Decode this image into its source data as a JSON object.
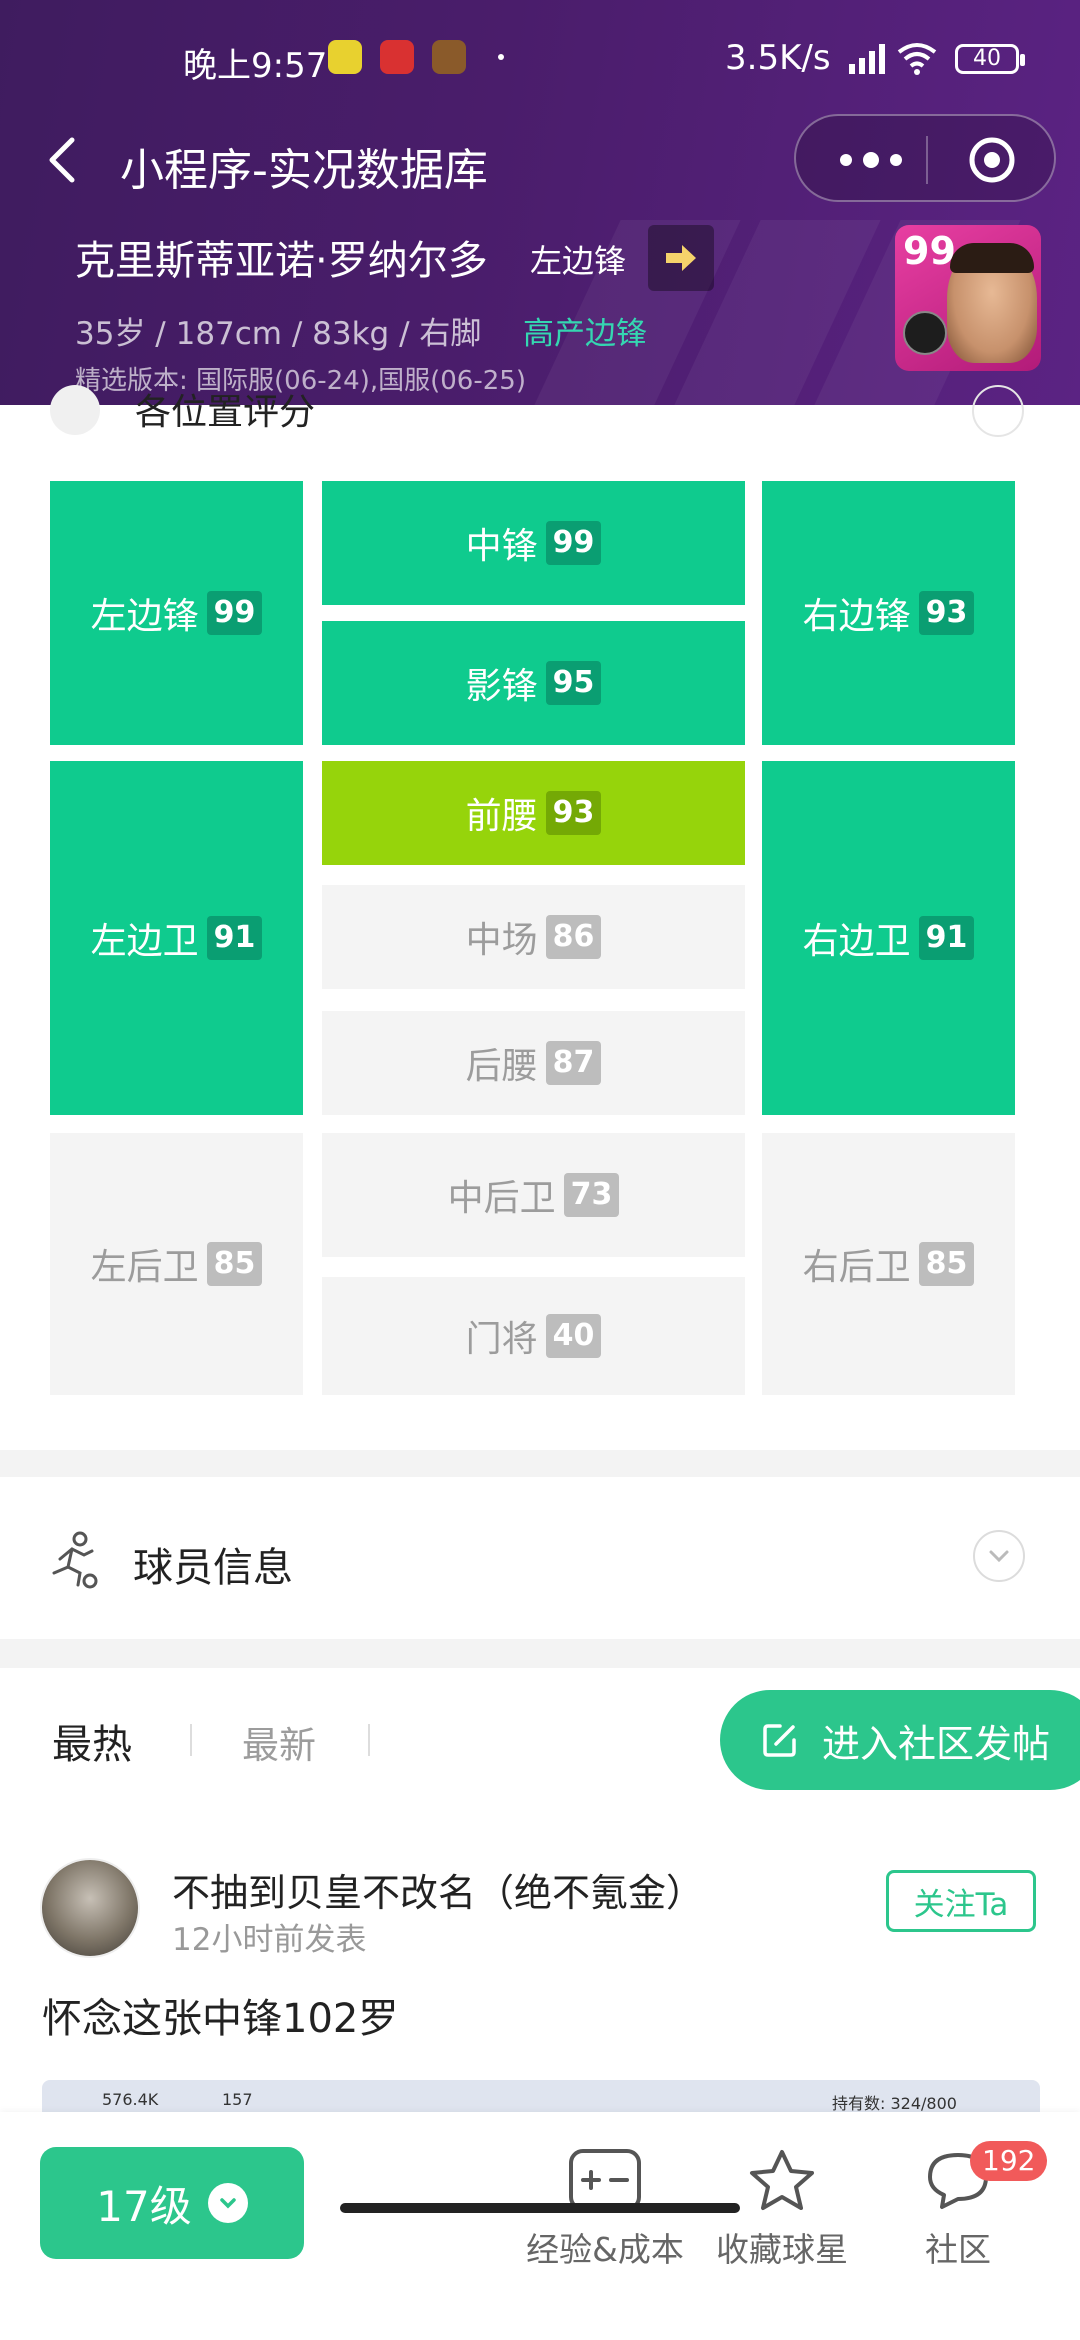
{
  "status_bar": {
    "time": "晚上9:57",
    "network_speed": "3.5K/s",
    "battery": "40"
  },
  "navbar": {
    "title": "小程序-实况数据库"
  },
  "player": {
    "name": "克里斯蒂亚诺·罗纳尔多",
    "position": "左边锋",
    "meta": "35岁 / 187cm / 83kg / 右脚",
    "tag": "高产边锋",
    "version": "精选版本: 国际服(06-24),国服(06-25)",
    "card_rating": "99"
  },
  "position_section": {
    "title_partial": "各位置评分",
    "positions": {
      "lwf": {
        "label": "左边锋",
        "value": "99",
        "state": "green"
      },
      "cf": {
        "label": "中锋",
        "value": "99",
        "state": "green"
      },
      "rwf": {
        "label": "右边锋",
        "value": "93",
        "state": "green"
      },
      "ss": {
        "label": "影锋",
        "value": "95",
        "state": "green"
      },
      "amf": {
        "label": "前腰",
        "value": "93",
        "state": "lime"
      },
      "lmf": {
        "label": "左边卫",
        "value": "91",
        "state": "green"
      },
      "cmf": {
        "label": "中场",
        "value": "86",
        "state": "gray"
      },
      "rmf": {
        "label": "右边卫",
        "value": "91",
        "state": "green"
      },
      "dmf": {
        "label": "后腰",
        "value": "87",
        "state": "gray"
      },
      "lb": {
        "label": "左后卫",
        "value": "85",
        "state": "gray"
      },
      "cb": {
        "label": "中后卫",
        "value": "73",
        "state": "gray"
      },
      "rb": {
        "label": "右后卫",
        "value": "85",
        "state": "gray"
      },
      "gk": {
        "label": "门将",
        "value": "40",
        "state": "gray"
      }
    }
  },
  "player_info": {
    "title": "球员信息"
  },
  "community": {
    "tab_hot": "最热",
    "tab_new": "最新",
    "post_button": "进入社区发帖",
    "post": {
      "author": "不抽到贝皇不改名（绝不氪金）",
      "time": "12小时前发表",
      "follow": "关注Ta",
      "text": "怀念这张中锋102罗",
      "image_stats": {
        "coins": "576.4K",
        "gp": "157",
        "owned": "持有数: 324/800"
      }
    }
  },
  "bottom_bar": {
    "level": "17级",
    "exp_cost": "经验&成本",
    "favorite": "收藏球星",
    "community": "社区",
    "community_count": "192"
  },
  "colors": {
    "header_purple": "#4a1d6b",
    "green": "#0fcb8e",
    "lime": "#96d40b",
    "accent_green": "#2cc68c",
    "badge_red": "#f15a5a"
  }
}
